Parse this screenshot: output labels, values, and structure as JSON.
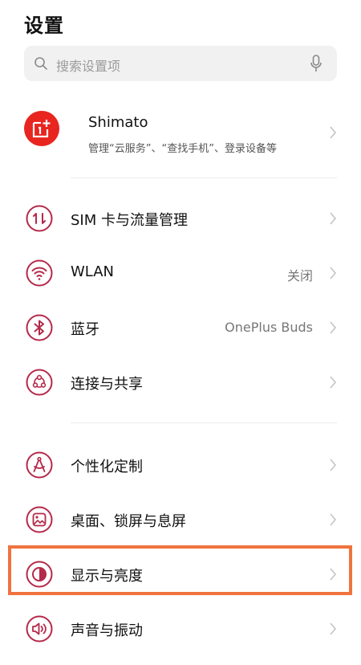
{
  "header": {
    "title": "设置"
  },
  "search": {
    "placeholder": "搜索设置项",
    "search_icon": "search-icon",
    "mic_icon": "microphone-icon"
  },
  "account": {
    "name": "Shimato",
    "subtitle": "管理“云服务”、“查找手机”、登录设备等",
    "avatar_icon": "oneplus-logo-icon",
    "avatar_color": "#e8251f"
  },
  "colors": {
    "accent": "#b5294a",
    "highlight_border": "#f0733f"
  },
  "sections": [
    {
      "items": [
        {
          "label": "SIM 卡与流量管理",
          "value": "",
          "icon": "sim-data-icon"
        },
        {
          "label": "WLAN",
          "value": "关闭",
          "icon": "wifi-icon"
        },
        {
          "label": "蓝牙",
          "value": "OnePlus Buds",
          "icon": "bluetooth-icon"
        },
        {
          "label": "连接与共享",
          "value": "",
          "icon": "share-connect-icon"
        }
      ]
    },
    {
      "items": [
        {
          "label": "个性化定制",
          "value": "",
          "icon": "personalize-icon"
        },
        {
          "label": "桌面、锁屏与息屏",
          "value": "",
          "icon": "wallpaper-icon"
        },
        {
          "label": "显示与亮度",
          "value": "",
          "icon": "display-brightness-icon"
        },
        {
          "label": "声音与振动",
          "value": "",
          "icon": "sound-icon"
        }
      ]
    }
  ]
}
